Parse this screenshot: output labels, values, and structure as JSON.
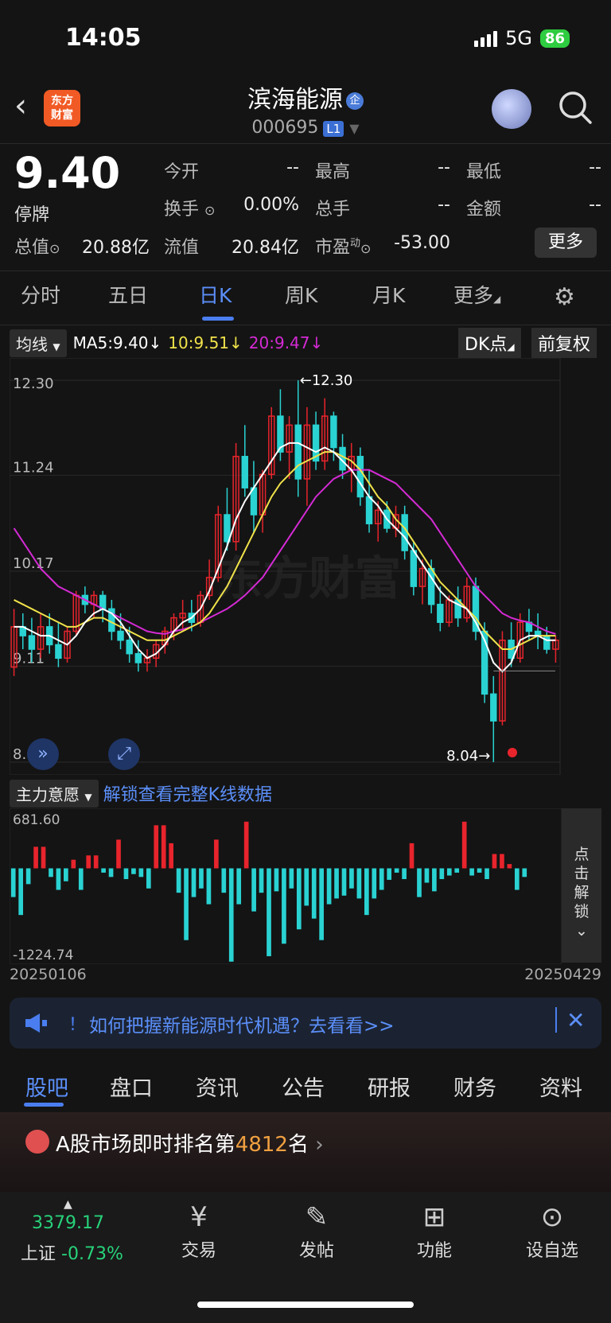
{
  "status": {
    "time": "14:05",
    "network": "5G",
    "battery": "86"
  },
  "header": {
    "app_logo": "东方\n财富",
    "stock_name": "滨海能源",
    "stock_code": "000695",
    "level": "L1"
  },
  "quote": {
    "price": "9.40",
    "status": "停牌",
    "rows": [
      [
        {
          "label": "今开",
          "value": "--"
        },
        {
          "label": "最高",
          "value": "--"
        },
        {
          "label": "最低",
          "value": "--"
        }
      ],
      [
        {
          "label": "换手",
          "value": "0.00%"
        },
        {
          "label": "总手",
          "value": "--"
        },
        {
          "label": "金额",
          "value": "--"
        }
      ],
      [
        {
          "label": "总值",
          "value": "20.88亿"
        },
        {
          "label": "流值",
          "value": "20.84亿"
        },
        {
          "label": "市盈",
          "value": "-53.00"
        }
      ]
    ],
    "more": "更多"
  },
  "period_tabs": [
    "分时",
    "五日",
    "日K",
    "周K",
    "月K",
    "更多"
  ],
  "active_period": "日K",
  "ma": {
    "selector": "均线",
    "ma5": "MA5:9.40↓",
    "ma10": "10:9.51↓",
    "ma20": "20:9.47↓",
    "dk": "DK点",
    "adjust": "前复权"
  },
  "colors": {
    "up": "#e8242c",
    "down": "#2ad2d2",
    "ma5": "#ffffff",
    "ma10": "#f0e24a",
    "ma20": "#d42ad4",
    "accent": "#4a7ef0",
    "green": "#27d27a"
  },
  "chart_data": {
    "type": "candlestick",
    "y_ticks": [
      "12.30",
      "11.24",
      "10.17",
      "9.11",
      "8.04"
    ],
    "ylim": [
      8.04,
      12.3
    ],
    "high_marker": "12.30",
    "low_marker": "8.04",
    "watermark": "东方财富",
    "candles": [
      [
        9.1,
        9.75,
        9.0,
        9.55
      ],
      [
        9.55,
        9.7,
        9.3,
        9.45
      ],
      [
        9.45,
        9.65,
        9.15,
        9.3
      ],
      [
        9.3,
        9.7,
        9.2,
        9.55
      ],
      [
        9.55,
        9.7,
        9.25,
        9.35
      ],
      [
        9.35,
        9.6,
        9.1,
        9.2
      ],
      [
        9.2,
        9.55,
        9.15,
        9.5
      ],
      [
        9.5,
        9.95,
        9.45,
        9.9
      ],
      [
        9.9,
        10.0,
        9.7,
        9.8
      ],
      [
        9.8,
        9.95,
        9.65,
        9.9
      ],
      [
        9.9,
        9.95,
        9.6,
        9.75
      ],
      [
        9.75,
        9.85,
        9.4,
        9.5
      ],
      [
        9.5,
        9.7,
        9.3,
        9.4
      ],
      [
        9.4,
        9.55,
        9.15,
        9.25
      ],
      [
        9.25,
        9.4,
        9.05,
        9.15
      ],
      [
        9.15,
        9.3,
        9.05,
        9.2
      ],
      [
        9.2,
        9.4,
        9.1,
        9.35
      ],
      [
        9.35,
        9.55,
        9.25,
        9.5
      ],
      [
        9.5,
        9.7,
        9.4,
        9.65
      ],
      [
        9.65,
        9.85,
        9.5,
        9.7
      ],
      [
        9.7,
        9.85,
        9.5,
        9.6
      ],
      [
        9.6,
        9.95,
        9.55,
        9.9
      ],
      [
        9.9,
        10.3,
        9.85,
        10.1
      ],
      [
        10.1,
        10.9,
        10.05,
        10.8
      ],
      [
        10.8,
        11.1,
        10.4,
        10.5
      ],
      [
        10.5,
        11.6,
        10.4,
        11.45
      ],
      [
        11.45,
        11.8,
        11.0,
        11.1
      ],
      [
        11.1,
        11.4,
        10.6,
        10.8
      ],
      [
        10.8,
        11.3,
        10.6,
        11.25
      ],
      [
        11.25,
        12.0,
        11.2,
        11.9
      ],
      [
        11.9,
        12.2,
        11.4,
        11.5
      ],
      [
        11.5,
        11.9,
        11.2,
        11.8
      ],
      [
        11.8,
        12.3,
        11.0,
        11.2
      ],
      [
        11.2,
        12.0,
        10.9,
        11.8
      ],
      [
        11.8,
        11.95,
        11.3,
        11.4
      ],
      [
        11.4,
        12.1,
        11.3,
        11.9
      ],
      [
        11.9,
        11.95,
        11.4,
        11.55
      ],
      [
        11.55,
        11.7,
        11.2,
        11.3
      ],
      [
        11.3,
        11.6,
        11.05,
        11.45
      ],
      [
        11.45,
        11.55,
        10.9,
        11.0
      ],
      [
        11.0,
        11.3,
        10.6,
        10.7
      ],
      [
        10.7,
        10.95,
        10.5,
        10.85
      ],
      [
        10.85,
        10.95,
        10.6,
        10.65
      ],
      [
        10.65,
        10.9,
        10.55,
        10.8
      ],
      [
        10.8,
        10.9,
        10.3,
        10.4
      ],
      [
        10.4,
        10.5,
        9.9,
        10.0
      ],
      [
        10.0,
        10.3,
        9.8,
        10.2
      ],
      [
        10.2,
        10.3,
        9.7,
        9.8
      ],
      [
        9.8,
        10.0,
        9.5,
        9.6
      ],
      [
        9.6,
        9.9,
        9.55,
        9.85
      ],
      [
        9.85,
        10.0,
        9.55,
        9.65
      ],
      [
        9.65,
        10.1,
        9.6,
        10.0
      ],
      [
        10.0,
        10.1,
        9.4,
        9.5
      ],
      [
        9.5,
        9.6,
        8.7,
        8.8
      ],
      [
        8.8,
        9.0,
        8.04,
        8.5
      ],
      [
        8.5,
        9.5,
        8.45,
        9.4
      ],
      [
        9.4,
        9.6,
        9.1,
        9.2
      ],
      [
        9.2,
        9.7,
        9.15,
        9.6
      ],
      [
        9.6,
        9.75,
        9.4,
        9.5
      ],
      [
        9.5,
        9.7,
        9.3,
        9.45
      ],
      [
        9.45,
        9.55,
        9.25,
        9.3
      ],
      [
        9.3,
        9.45,
        9.15,
        9.4
      ]
    ],
    "ma5": [
      9.55,
      9.55,
      9.5,
      9.45,
      9.45,
      9.4,
      9.35,
      9.45,
      9.6,
      9.7,
      9.75,
      9.7,
      9.6,
      9.45,
      9.3,
      9.2,
      9.25,
      9.35,
      9.5,
      9.6,
      9.65,
      9.75,
      9.95,
      10.2,
      10.45,
      10.75,
      10.95,
      11.1,
      11.25,
      11.4,
      11.55,
      11.6,
      11.6,
      11.55,
      11.5,
      11.55,
      11.5,
      11.4,
      11.3,
      11.15,
      11.0,
      10.9,
      10.75,
      10.65,
      10.55,
      10.4,
      10.25,
      10.1,
      9.95,
      9.85,
      9.8,
      9.75,
      9.6,
      9.4,
      9.15,
      9.05,
      9.15,
      9.4,
      9.45,
      9.45,
      9.4,
      9.4
    ],
    "ma10": [
      9.85,
      9.8,
      9.75,
      9.7,
      9.65,
      9.6,
      9.55,
      9.55,
      9.6,
      9.65,
      9.65,
      9.6,
      9.55,
      9.5,
      9.45,
      9.4,
      9.4,
      9.4,
      9.45,
      9.5,
      9.55,
      9.6,
      9.7,
      9.85,
      10.0,
      10.2,
      10.4,
      10.6,
      10.8,
      11.0,
      11.15,
      11.25,
      11.35,
      11.4,
      11.45,
      11.5,
      11.5,
      11.45,
      11.4,
      11.3,
      11.15,
      11.0,
      10.9,
      10.75,
      10.65,
      10.5,
      10.35,
      10.2,
      10.05,
      9.95,
      9.85,
      9.75,
      9.65,
      9.5,
      9.4,
      9.3,
      9.3,
      9.35,
      9.4,
      9.45,
      9.45,
      9.45
    ],
    "ma20": [
      10.65,
      10.5,
      10.35,
      10.2,
      10.1,
      10.0,
      9.95,
      9.9,
      9.85,
      9.8,
      9.75,
      9.7,
      9.65,
      9.6,
      9.55,
      9.5,
      9.48,
      9.47,
      9.5,
      9.52,
      9.55,
      9.6,
      9.65,
      9.7,
      9.75,
      9.82,
      9.9,
      10.0,
      10.1,
      10.25,
      10.4,
      10.55,
      10.7,
      10.85,
      11.0,
      11.1,
      11.2,
      11.25,
      11.3,
      11.3,
      11.3,
      11.25,
      11.2,
      11.15,
      11.05,
      10.95,
      10.85,
      10.75,
      10.6,
      10.45,
      10.3,
      10.15,
      10.0,
      9.9,
      9.8,
      9.7,
      9.65,
      9.62,
      9.6,
      9.55,
      9.5,
      9.47
    ]
  },
  "indicator": {
    "selector": "主力意愿",
    "unlock_text": "解锁查看完整K线数据",
    "max_label": "681.60",
    "min_label": "-1224.74",
    "side_unlock": "点击解锁",
    "values": [
      -400,
      -650,
      -220,
      300,
      300,
      -120,
      -300,
      -180,
      120,
      -300,
      180,
      180,
      -60,
      -120,
      400,
      -150,
      -80,
      -120,
      -280,
      600,
      600,
      350,
      -340,
      -1000,
      -400,
      -280,
      -500,
      400,
      -340,
      -1300,
      -500,
      650,
      -600,
      -340,
      -1224,
      -320,
      -1050,
      -280,
      -850,
      -520,
      -700,
      -1000,
      -500,
      -420,
      -380,
      -280,
      -420,
      -650,
      -420,
      -300,
      -160,
      -60,
      -150,
      350,
      -400,
      -200,
      -320,
      -150,
      -100,
      -60,
      650,
      -100,
      -60,
      -150,
      200,
      200,
      60,
      -300,
      -120
    ],
    "start_date": "20250106",
    "end_date": "20250429"
  },
  "news": {
    "text": "如何把握新能源时代机遇？去看看>>",
    "mark": "！"
  },
  "bottom_tabs": [
    "股吧",
    "盘口",
    "资讯",
    "公告",
    "研报",
    "财务",
    "资料"
  ],
  "active_bottom_tab": "股吧",
  "rank": {
    "prefix": "A股市场即时排名第",
    "number": "4812",
    "suffix": "名"
  },
  "nav": {
    "index_value": "3379.17",
    "index_name": "上证",
    "index_change": "-0.73%",
    "items": [
      {
        "label": "交易",
        "icon": "yuan-icon"
      },
      {
        "label": "发帖",
        "icon": "edit-icon"
      },
      {
        "label": "功能",
        "icon": "grid-icon"
      },
      {
        "label": "设自选",
        "icon": "dots-icon"
      }
    ]
  }
}
